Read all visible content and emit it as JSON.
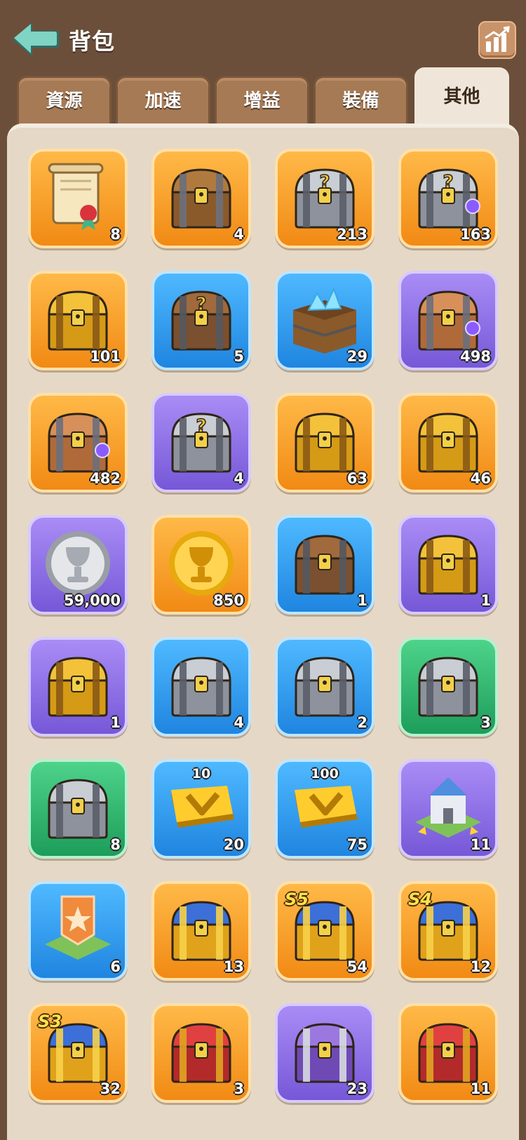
{
  "header": {
    "title": "背包",
    "back_icon": "back-arrow-icon",
    "stats_icon": "bar-chart-icon"
  },
  "tabs": [
    {
      "label": "資源",
      "active": false
    },
    {
      "label": "加速",
      "active": false
    },
    {
      "label": "增益",
      "active": false
    },
    {
      "label": "裝備",
      "active": false
    },
    {
      "label": "其他",
      "active": true
    }
  ],
  "items": [
    {
      "icon": "scroll-icon",
      "bg": "orange",
      "count": "8"
    },
    {
      "icon": "hero-chest-icon",
      "bg": "orange",
      "count": "4"
    },
    {
      "icon": "mystery-equipment-chest-icon",
      "bg": "orange",
      "count": "213"
    },
    {
      "icon": "mystery-gem-chest-icon",
      "bg": "orange",
      "count": "163"
    },
    {
      "icon": "golden-scroll-chest-icon",
      "bg": "orange",
      "count": "101"
    },
    {
      "icon": "wooden-mystery-chest-icon",
      "bg": "blue",
      "count": "5"
    },
    {
      "icon": "crystal-crate-icon",
      "bg": "blue",
      "count": "29"
    },
    {
      "icon": "bronze-gem-chest-icon",
      "bg": "purple",
      "count": "498"
    },
    {
      "icon": "bronze-gem-chest-icon",
      "bg": "orange",
      "count": "482"
    },
    {
      "icon": "silver-mystery-chest-icon",
      "bg": "purple",
      "count": "4"
    },
    {
      "icon": "gold-trim-chest-icon",
      "bg": "orange",
      "count": "63"
    },
    {
      "icon": "ornate-gold-chest-icon",
      "bg": "orange",
      "count": "46"
    },
    {
      "icon": "silver-trophy-coin-icon",
      "bg": "purple",
      "count": "59,000"
    },
    {
      "icon": "gold-trophy-coin-icon",
      "bg": "orange",
      "count": "850"
    },
    {
      "icon": "potion-chest-icon",
      "bg": "blue",
      "count": "1"
    },
    {
      "icon": "starfish-chest-icon",
      "bg": "purple",
      "count": "1"
    },
    {
      "icon": "hammer-chest-icon",
      "bg": "purple",
      "count": "1"
    },
    {
      "icon": "exp-book-chest-icon",
      "bg": "blue",
      "count": "4"
    },
    {
      "icon": "scroll-shell-chest-icon",
      "bg": "blue",
      "count": "2"
    },
    {
      "icon": "speedup-chest-icon",
      "bg": "green",
      "count": "3"
    },
    {
      "icon": "speedup-chest-icon",
      "bg": "green",
      "count": "8"
    },
    {
      "icon": "vip-token-icon",
      "bg": "blue",
      "count": "20",
      "top_label": "10"
    },
    {
      "icon": "vip-token-icon",
      "bg": "blue",
      "count": "75",
      "top_label": "100"
    },
    {
      "icon": "castle-relocate-icon",
      "bg": "purple",
      "count": "11"
    },
    {
      "icon": "banner-relocate-icon",
      "bg": "blue",
      "count": "6"
    },
    {
      "icon": "treasure-pile-chest-icon",
      "bg": "orange",
      "count": "13"
    },
    {
      "icon": "season-chest-icon",
      "bg": "orange",
      "count": "54",
      "season": "S5"
    },
    {
      "icon": "season-chest-icon",
      "bg": "orange",
      "count": "12",
      "season": "S4"
    },
    {
      "icon": "season-chest-icon",
      "bg": "orange",
      "count": "32",
      "season": "S3"
    },
    {
      "icon": "red-gold-chest-icon",
      "bg": "orange",
      "count": "3"
    },
    {
      "icon": "purple-silver-chest-icon",
      "bg": "purple",
      "count": "23"
    },
    {
      "icon": "red-gold-chest-icon",
      "bg": "orange",
      "count": "11"
    }
  ],
  "colors": {
    "background": "#6b4f3a",
    "panel": "#e6d8c6",
    "orange": "#f5a030",
    "blue": "#2f9af0",
    "purple": "#8a70e6",
    "green": "#2fb86f"
  }
}
